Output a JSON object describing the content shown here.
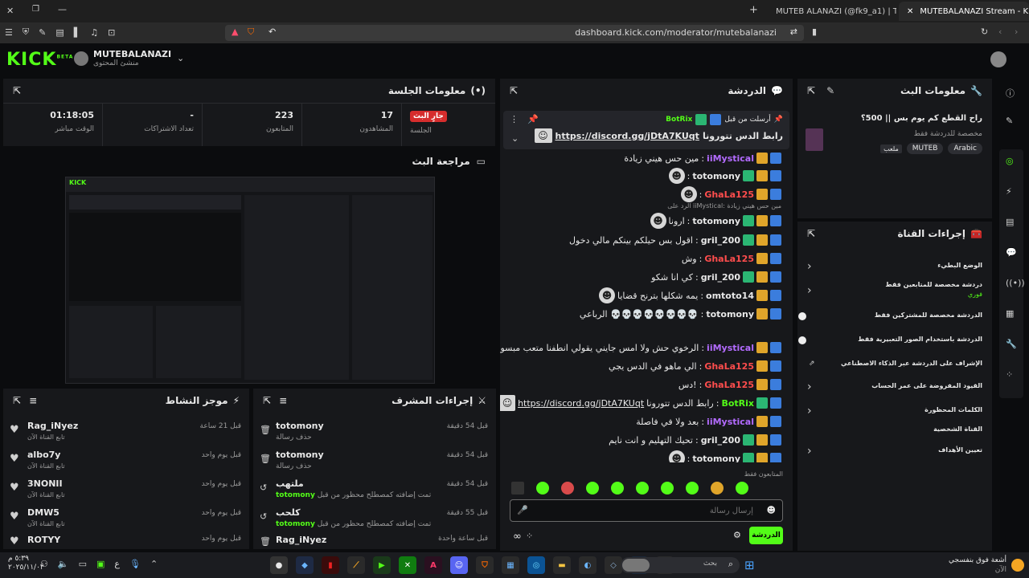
{
  "browser": {
    "tabs": [
      {
        "label": "MUTEB ALANAZI (@fk9_a1) | TikTok(2)",
        "active": false
      },
      {
        "label": "MUTEBALANAZI Stream - Kick D",
        "active": true
      }
    ],
    "url": "dashboard.kick.com/moderator/mutebalanazi"
  },
  "header": {
    "logo": "KICK",
    "logo_sup": "BETA",
    "channel_name": "MUTEBALANAZI",
    "channel_role": "منشئ المحتوى"
  },
  "session": {
    "title": "معلومات الجلسة",
    "status": "جارٍ البث",
    "status_label": "الجلسة",
    "stats": [
      {
        "value": "17",
        "label": "المشاهدون"
      },
      {
        "value": "223",
        "label": "المتابعون"
      },
      {
        "value": "-",
        "label": "تعداد الاشتراكات"
      },
      {
        "value": "01:18:05",
        "label": "الوقت مباشر"
      }
    ]
  },
  "preview": {
    "title": "مراجعة البث"
  },
  "activity": {
    "title": "موجز النشاط",
    "items": [
      {
        "user": "Rag_iNyez",
        "desc": "تابع القناة الآن",
        "time": "قبل 21 ساعة"
      },
      {
        "user": "albo7y",
        "desc": "تابع القناة الآن",
        "time": "قبل يوم واحد"
      },
      {
        "user": "3NONII",
        "desc": "تابع القناة الآن",
        "time": "قبل يوم واحد"
      },
      {
        "user": "DMW5",
        "desc": "تابع القناة الآن",
        "time": "قبل يوم واحد"
      },
      {
        "user": "ROTYY",
        "desc": "",
        "time": "قبل يوم واحد"
      }
    ]
  },
  "modactions": {
    "title": "إجراءات المشرف",
    "items": [
      {
        "user": "totomony",
        "desc": "حذف رسالة",
        "time": "قبل 54 دقيقة",
        "icon": "trash-icon"
      },
      {
        "user": "totomony",
        "desc": "حذف رسالة",
        "time": "قبل 54 دقيقة",
        "icon": "trash-icon"
      },
      {
        "user": "ملتهب",
        "desc": "تمت إضافته كمصطلح محظور من قبل",
        "by": "totomony",
        "time": "قبل 54 دقيقة",
        "icon": "undo-icon"
      },
      {
        "user": "كلحب",
        "desc": "تمت إضافته كمصطلح محظور من قبل",
        "by": "totomony",
        "time": "قبل 55 دقيقة",
        "icon": "undo-icon"
      },
      {
        "user": "Rag_iNyez",
        "desc": "",
        "time": "قبل ساعة واحدة",
        "icon": "trash-icon"
      }
    ]
  },
  "chat": {
    "title": "الدردشة",
    "pinned": {
      "label": "أرسلت من قبل",
      "user": "BotRix",
      "text": "رابط الدس تتورونا",
      "link": "https://discord.gg/jDtA7KUqt"
    },
    "messages": [
      {
        "user": "iiMystical",
        "color": "#b36bff",
        "text": "مين حس هيني زيادة"
      },
      {
        "user": "totomony",
        "color": "#e8e8e8",
        "text": "",
        "emote": true
      },
      {
        "user": "GhaLa125",
        "color": "#ff4d4d",
        "text": "",
        "emote": true
      },
      {
        "reply": "الرد على iiMystical: مين حس هيني زيادة"
      },
      {
        "user": "totomony",
        "color": "#e8e8e8",
        "text": "ارونا",
        "emote": true
      },
      {
        "user": "gril_200",
        "color": "#e8e8e8",
        "text": "اقول بس حيلكم بينكم مالي دخول"
      },
      {
        "user": "GhaLa125",
        "color": "#ff4d4d",
        "text": "وش"
      },
      {
        "user": "gril_200",
        "color": "#e8e8e8",
        "text": "كي انا شكو"
      },
      {
        "user": "omtoto14",
        "color": "#e8e8e8",
        "text": "يمه شكلها بترنح قضايا",
        "emote": true
      },
      {
        "user": "totomony",
        "color": "#e8e8e8",
        "text": "الرباعي 💀💀💀💀💀💀💀💀"
      },
      {
        "user": "iiMystical",
        "color": "#b36bff",
        "text": "الرخوي حش ولا امس جايني يقولي انطفنا متعب مبسوط"
      },
      {
        "user": "GhaLa125",
        "color": "#ff4d4d",
        "text": "الي ماهو في الدس يجي"
      },
      {
        "user": "GhaLa125",
        "color": "#ff4d4d",
        "text": "دس!"
      },
      {
        "user": "BotRix",
        "color": "#53fc18",
        "text": "رابط الدس تتورونا",
        "link": "https://discord.gg/jDtA7KUqt"
      },
      {
        "user": "iiMystical",
        "color": "#b36bff",
        "text": "بعد ولا في فاصلة"
      },
      {
        "user": "gril_200",
        "color": "#e8e8e8",
        "text": "تحيك التهليم و انت نايم"
      },
      {
        "user": "totomony",
        "color": "#e8e8e8",
        "text": "",
        "emote": true
      }
    ],
    "followers_label": "المتابعون فقط",
    "input_placeholder": "إرسال رسالة",
    "send_label": "الدردشة"
  },
  "streaminfo": {
    "title": "معلومات البث",
    "stream_title": "راح القطع كم يوم بس || 500؟",
    "category": "مخصصة للدردشة فقط",
    "tags": [
      "Arabic",
      "MUTEB"
    ],
    "mature": "ملعب"
  },
  "channelactions": {
    "title": "إجراءات القناة",
    "items": [
      {
        "label": "الوضع البطيء",
        "kind": "chevron"
      },
      {
        "label": "دردشة مخصصة للمتابعين فقط",
        "sub": "فوري",
        "kind": "chevron"
      },
      {
        "label": "الدردشة مخصصة للمشتركين فقط",
        "kind": "toggle"
      },
      {
        "label": "الدردشة باستخدام الصور التعبيرية فقط",
        "kind": "toggle"
      },
      {
        "label": "الإشراف على الدردشة عبر الذكاء الاصطناعي",
        "kind": "external"
      },
      {
        "label": "القيود المفروضة على عمر الحساب",
        "kind": "chevron"
      },
      {
        "label": "الكلمات المحظورة",
        "kind": "chevron"
      },
      {
        "label": "القناة الشخصية",
        "kind": "none"
      },
      {
        "label": "تعيين الأهداف",
        "kind": "chevron"
      }
    ]
  },
  "taskbar": {
    "time": "٥:٣٩ م",
    "date": "٢٠٢٥/١١/٠٣",
    "lang": "ع",
    "search": "بحث",
    "weather": "أشعة فوق بنفسجي",
    "weather_sub": "الآن"
  },
  "colors": {
    "brand": "#53fc18",
    "panel": "#17181b",
    "bg": "#0b0c0e",
    "mod": "#3b7ddd"
  }
}
